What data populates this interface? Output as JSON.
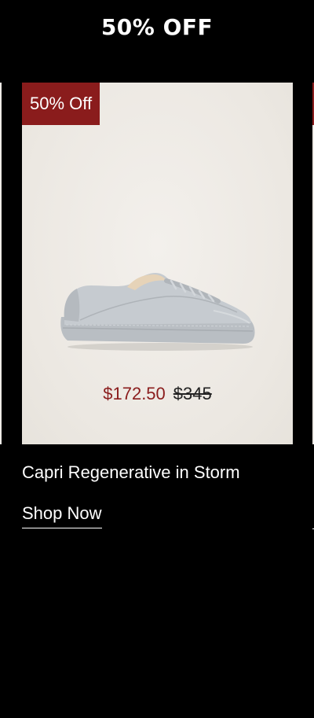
{
  "header": {
    "title": "50% OFF"
  },
  "product": {
    "badge_label": "50% Off",
    "sale_price": "$172.50",
    "original_price": "$345",
    "name": "Capri Regenerative in Storm",
    "cta_label": "Shop Now",
    "image_icon": "sneaker-image"
  },
  "colors": {
    "background": "#000000",
    "badge": "#8a1c1c",
    "sale_price": "#8a1c1c",
    "image_background": "#eeebe6",
    "text": "#ffffff"
  }
}
